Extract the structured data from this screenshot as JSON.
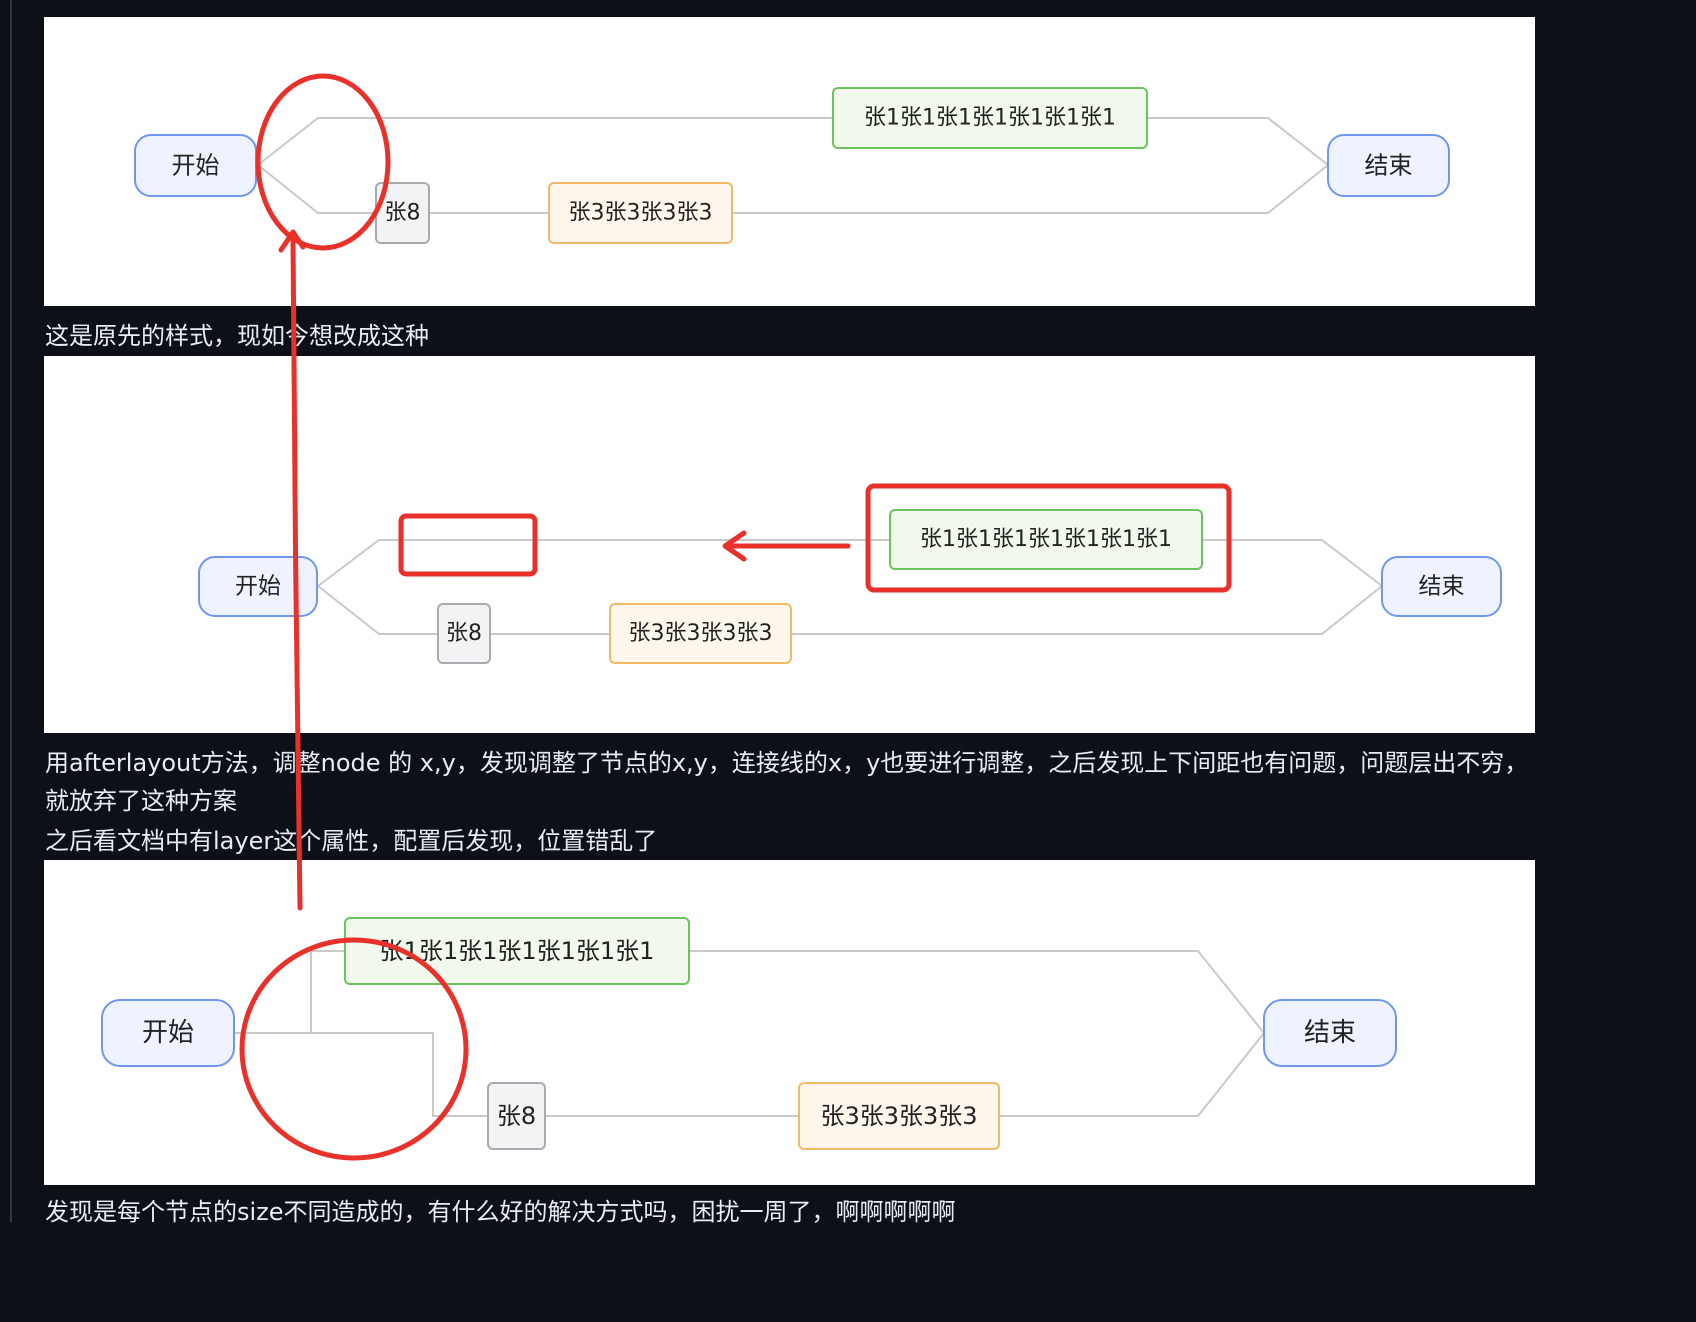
{
  "captions": {
    "c1": "这是原先的样式，现如今想改成这种",
    "c2": "用afterlayout方法，调整node 的 x,y，发现调整了节点的x,y，连接线的x，y也要进行调整，之后发现上下间距也有问题，问题层出不穷，就放弃了这种方案",
    "c3": "之后看文档中有layer这个属性，配置后发现，位置错乱了",
    "c4": "发现是每个节点的size不同造成的，有什么好的解决方式吗，困扰一周了，啊啊啊啊啊"
  },
  "diagram1": {
    "start": "开始",
    "end": "结束",
    "node_a": "张1张1张1张1张1张1张1",
    "node_b": "张8",
    "node_c": "张3张3张3张3"
  },
  "diagram2": {
    "start": "开始",
    "end": "结束",
    "node_a": "张1张1张1张1张1张1张1",
    "node_b": "张8",
    "node_c": "张3张3张3张3"
  },
  "diagram3": {
    "start": "开始",
    "end": "结束",
    "node_a": "张1张1张1张1张1张1张1",
    "node_b": "张8",
    "node_c": "张3张3张3张3"
  },
  "colors": {
    "start_end_fill": "#eef3ff",
    "start_end_stroke": "#6f97f0",
    "green_fill": "#f1f9ec",
    "green_stroke": "#6cc45e",
    "gray_fill": "#f3f3f5",
    "gray_stroke": "#a9a9b0",
    "orange_fill": "#fff7ec",
    "orange_stroke": "#f1b867",
    "annotation": "#e8312b"
  }
}
